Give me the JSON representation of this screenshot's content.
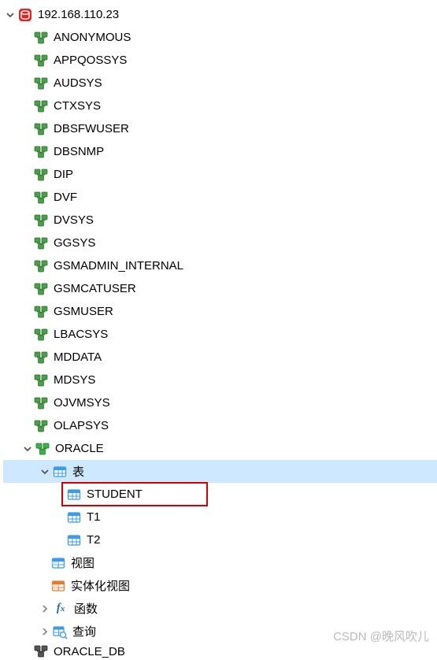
{
  "root": {
    "label": "192.168.110.23",
    "expanded": true
  },
  "schemas": [
    "ANONYMOUS",
    "APPQOSSYS",
    "AUDSYS",
    "CTXSYS",
    "DBSFWUSER",
    "DBSNMP",
    "DIP",
    "DVF",
    "DVSYS",
    "GGSYS",
    "GSMADMIN_INTERNAL",
    "GSMCATUSER",
    "GSMUSER",
    "LBACSYS",
    "MDDATA",
    "MDSYS",
    "OJVMSYS",
    "OLAPSYS"
  ],
  "active_schema": {
    "label": "ORACLE",
    "tables_folder": "表",
    "tables": [
      "STUDENT",
      "T1",
      "T2"
    ],
    "views_folder": "视图",
    "mviews_folder": "实体化视图",
    "functions_folder": "函数",
    "queries_folder": "查询"
  },
  "bottom_schema": "ORACLE_DB",
  "watermark": "CSDN @晚风吹儿",
  "colors": {
    "db_badge": "#e52421",
    "schema_icon": "#3f8f3f",
    "active_schema_icon": "#2fa82f",
    "table_icon": "#3d9be9",
    "view_icon": "#3d9be9",
    "mview_icon": "#e87a2e",
    "fx_icon": "#2d6fb5",
    "query_icon": "#3d9be9",
    "selection": "#cde8ff",
    "highlight_border": "#d20000"
  }
}
